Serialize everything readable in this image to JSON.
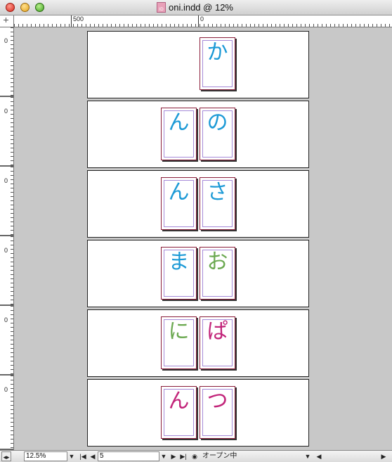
{
  "window": {
    "title": "oni.indd @ 12%",
    "doc_icon_label": "ID"
  },
  "ruler": {
    "h_label_left": "500",
    "h_label_right": "0",
    "v_label": "0"
  },
  "spreads": [
    {
      "left_char": "",
      "right_char": "か",
      "left_color": "",
      "right_color": "#1d9ad6",
      "single": true
    },
    {
      "left_char": "ん",
      "right_char": "の",
      "left_color": "#1d9ad6",
      "right_color": "#1d9ad6",
      "single": false
    },
    {
      "left_char": "ん",
      "right_char": "さ",
      "left_color": "#1d9ad6",
      "right_color": "#1d9ad6",
      "single": false
    },
    {
      "left_char": "ま",
      "right_char": "お",
      "left_color": "#1d9ad6",
      "right_color": "#6aa84f",
      "single": false
    },
    {
      "left_char": "に",
      "right_char": "ぱ",
      "left_color": "#6aa84f",
      "right_color": "#c2257a",
      "single": false
    },
    {
      "left_char": "ん",
      "right_char": "つ",
      "left_color": "#c2257a",
      "right_color": "#c2257a",
      "single": false
    }
  ],
  "status": {
    "zoom_value": "12.5%",
    "page_value": "5",
    "status_text": "オープン中"
  },
  "colors": {
    "pasteboard": "#c8c8c8",
    "page_border": "#8a1d3a",
    "margin_guide": "#a58ad8"
  }
}
